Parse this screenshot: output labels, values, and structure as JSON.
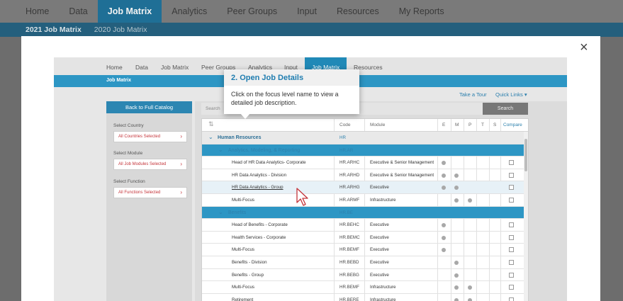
{
  "top_nav": {
    "items": [
      {
        "label": "Home",
        "active": false
      },
      {
        "label": "Data",
        "active": false
      },
      {
        "label": "Job Matrix",
        "active": true
      },
      {
        "label": "Analytics",
        "active": false
      },
      {
        "label": "Peer Groups",
        "active": false
      },
      {
        "label": "Input",
        "active": false
      },
      {
        "label": "Resources",
        "active": false
      },
      {
        "label": "My Reports",
        "active": false
      }
    ]
  },
  "sub_nav": {
    "items": [
      {
        "label": "2021 Job Matrix",
        "active": true
      },
      {
        "label": "2020 Job Matrix",
        "active": false
      }
    ]
  },
  "carousel": {
    "prev_icon": "chevron-left-icon",
    "next_icon": "chevron-right-icon"
  },
  "modal": {
    "close_glyph": "×",
    "tooltip": {
      "title": "2. Open Job Details",
      "body": "Click on the focus level name to view a detailed job description."
    },
    "inner": {
      "nav": [
        "Home",
        "Data",
        "Job Matrix",
        "Peer Groups",
        "Analytics",
        "Input",
        "Job Matrix",
        "Resources"
      ],
      "sub_title": "Job Matrix",
      "take_tour": "Take a Tour",
      "quick_links": "Quick Links",
      "back_button": "Back to Full Catalog",
      "filters": [
        {
          "label": "Select Country",
          "value": "All Countries Selected"
        },
        {
          "label": "Select Module",
          "value": "All Job Modules Selected"
        },
        {
          "label": "Select Function",
          "value": "All Functions Selected"
        }
      ],
      "search_placeholder": "Search",
      "search_button": "Search",
      "table": {
        "headers": {
          "code": "Code",
          "module": "Module",
          "e": "E",
          "m": "M",
          "p": "P",
          "t": "T",
          "s": "S",
          "compare": "Compare"
        },
        "rows": [
          {
            "type": "group",
            "name": "Human Resources",
            "code": "HR",
            "module": "",
            "dots": []
          },
          {
            "type": "sub",
            "name": "Analytics, Modeling, & Reporting",
            "code": "HR.AR",
            "module": "",
            "dots": []
          },
          {
            "type": "item",
            "name": "Head of HR Data Analytics- Corporate",
            "code": "HR.ARHC",
            "module": "Executive & Senior Management",
            "dots": [
              "e"
            ]
          },
          {
            "type": "item",
            "name": "HR Data Analytics - Division",
            "code": "HR.ARHD",
            "module": "Executive & Senior Management",
            "dots": [
              "e",
              "m"
            ]
          },
          {
            "type": "hl",
            "name": "HR Data Analytics - Group",
            "code": "HR.ARHG",
            "module": "Executive",
            "dots": [
              "e",
              "m"
            ]
          },
          {
            "type": "item",
            "name": "Multi-Focus",
            "code": "HR.ARMF",
            "module": "Infrastructure",
            "dots": [
              "m",
              "p"
            ]
          },
          {
            "type": "sub",
            "name": "Benefits",
            "code": "HR.BE",
            "module": "",
            "dots": []
          },
          {
            "type": "item",
            "name": "Head of Benefits - Corporate",
            "code": "HR.BEHC",
            "module": "Executive",
            "dots": [
              "e"
            ]
          },
          {
            "type": "item",
            "name": "Health Services - Corporate",
            "code": "HR.BEMC",
            "module": "Executive",
            "dots": [
              "e"
            ]
          },
          {
            "type": "item",
            "name": "Multi-Focus",
            "code": "HR.BEMF",
            "module": "Executive",
            "dots": [
              "e"
            ]
          },
          {
            "type": "item",
            "name": "Benefits - Division",
            "code": "HR.BEBD",
            "module": "Executive",
            "dots": [
              "m"
            ]
          },
          {
            "type": "item",
            "name": "Benefits - Group",
            "code": "HR.BEBG",
            "module": "Executive",
            "dots": [
              "m"
            ]
          },
          {
            "type": "item",
            "name": "Multi-Focus",
            "code": "HR.BEMF",
            "module": "Infrastructure",
            "dots": [
              "m",
              "p"
            ]
          },
          {
            "type": "item",
            "name": "Retirement",
            "code": "HR.BERE",
            "module": "Infrastructure",
            "dots": [
              "m",
              "p"
            ]
          }
        ]
      }
    }
  },
  "colors": {
    "accent": "#1f6f96",
    "inner_accent": "#2d96c4",
    "tooltip_title": "#1f7db0"
  }
}
